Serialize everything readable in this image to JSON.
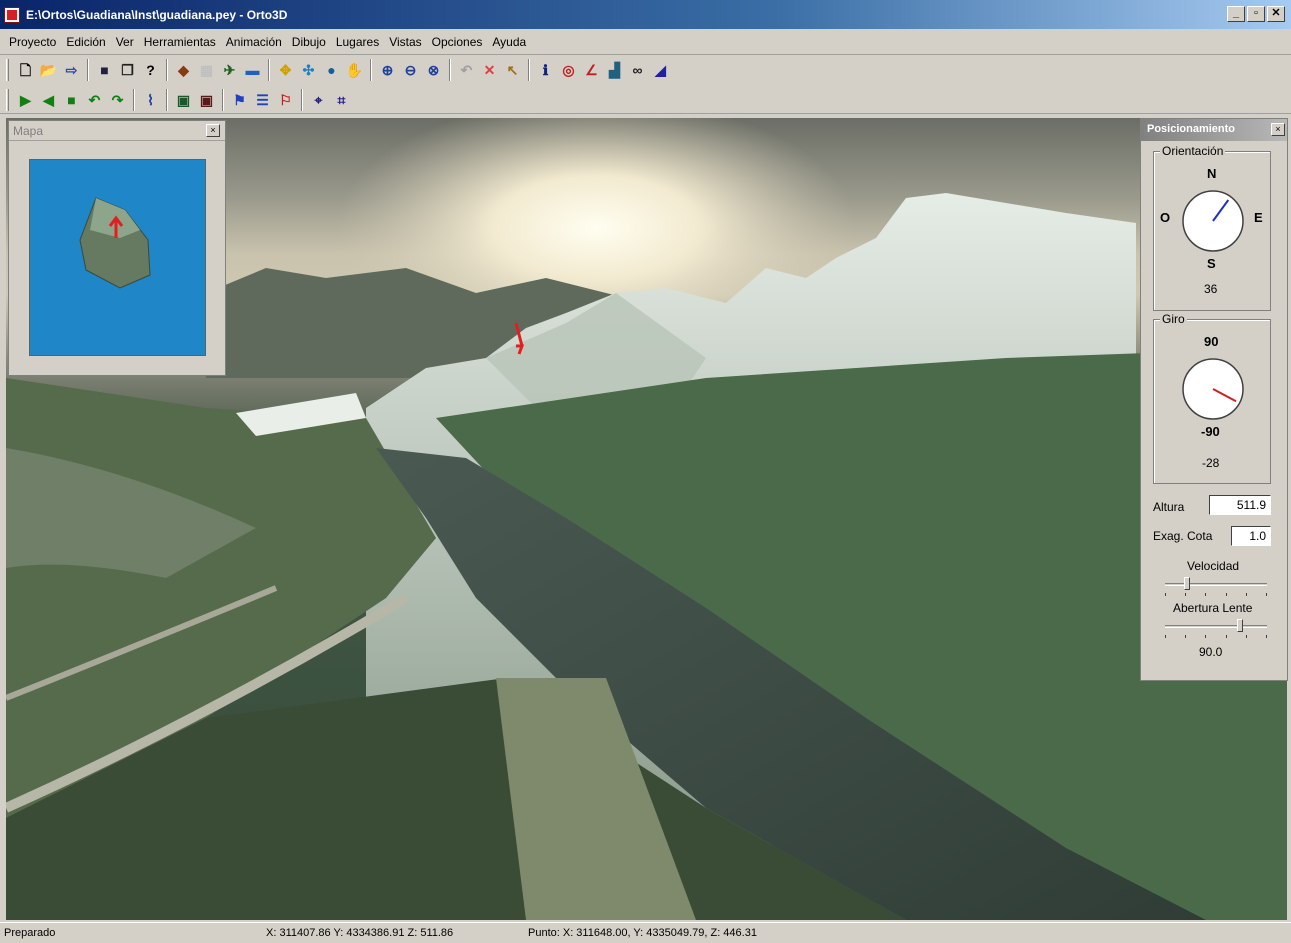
{
  "window": {
    "title": "E:\\Ortos\\Guadiana\\Inst\\guadiana.pey - Orto3D",
    "min_label": "_",
    "max_label": "▫",
    "close_label": "✕"
  },
  "menu": [
    "Proyecto",
    "Edición",
    "Ver",
    "Herramientas",
    "Animación",
    "Dibujo",
    "Lugares",
    "Vistas",
    "Opciones",
    "Ayuda"
  ],
  "toolbar1": [
    {
      "icon": "new-file-icon",
      "glyph": "🗋",
      "color": "#000000"
    },
    {
      "icon": "open-folder-icon",
      "glyph": "📂",
      "color": "#c89a20"
    },
    {
      "icon": "open-recent-icon",
      "glyph": "⇨",
      "color": "#2050b0"
    },
    {
      "sep": true
    },
    {
      "icon": "save-icon",
      "glyph": "■",
      "color": "#202040"
    },
    {
      "icon": "copy-icon",
      "glyph": "❐",
      "color": "#202020"
    },
    {
      "icon": "help-icon",
      "glyph": "?",
      "color": "#000000"
    },
    {
      "sep": true
    },
    {
      "icon": "terrain-icon",
      "glyph": "◆",
      "color": "#8a3a10"
    },
    {
      "icon": "grid-icon",
      "glyph": "▦",
      "color": "#c0c0c0"
    },
    {
      "icon": "plane-icon",
      "glyph": "✈",
      "color": "#206020"
    },
    {
      "icon": "landscape-icon",
      "glyph": "▬",
      "color": "#2060c0"
    },
    {
      "sep": true
    },
    {
      "icon": "move-icon",
      "glyph": "✥",
      "color": "#d0a000"
    },
    {
      "icon": "rotate-icon",
      "glyph": "✣",
      "color": "#2080c0"
    },
    {
      "icon": "globe-icon",
      "glyph": "●",
      "color": "#1060a0"
    },
    {
      "icon": "hand-icon",
      "glyph": "✋",
      "color": "#c0a080"
    },
    {
      "sep": true
    },
    {
      "icon": "zoom-in-icon",
      "glyph": "⊕",
      "color": "#2040a0"
    },
    {
      "icon": "zoom-out-icon",
      "glyph": "⊖",
      "color": "#2040a0"
    },
    {
      "icon": "zoom-extent-icon",
      "glyph": "⊗",
      "color": "#2040a0"
    },
    {
      "sep": true
    },
    {
      "icon": "undo-disabled-icon",
      "glyph": "↶",
      "color": "#a0a0a0"
    },
    {
      "icon": "delete-icon",
      "glyph": "✕",
      "color": "#e04040"
    },
    {
      "icon": "pick-icon",
      "glyph": "↖",
      "color": "#a07010"
    },
    {
      "sep": true
    },
    {
      "icon": "info-icon",
      "glyph": "ℹ",
      "color": "#102080"
    },
    {
      "icon": "eye-icon",
      "glyph": "◎",
      "color": "#c02020"
    },
    {
      "icon": "measure-icon",
      "glyph": "∠",
      "color": "#c02020"
    },
    {
      "icon": "profile-icon",
      "glyph": "▟",
      "color": "#206080"
    },
    {
      "icon": "binoculars-icon",
      "glyph": "∞",
      "color": "#202020"
    },
    {
      "icon": "draw-area-icon",
      "glyph": "◢",
      "color": "#2020a0"
    }
  ],
  "toolbar2": [
    {
      "icon": "play-icon",
      "glyph": "▶",
      "color": "#108010"
    },
    {
      "icon": "play-back-icon",
      "glyph": "◀",
      "color": "#108010"
    },
    {
      "icon": "stop-icon",
      "glyph": "■",
      "color": "#108010"
    },
    {
      "icon": "rotate-left-icon",
      "glyph": "↶",
      "color": "#108010"
    },
    {
      "icon": "rotate-right-icon",
      "glyph": "↷",
      "color": "#108010"
    },
    {
      "sep": true
    },
    {
      "icon": "path-icon",
      "glyph": "⌇",
      "color": "#2040a0"
    },
    {
      "sep": true
    },
    {
      "icon": "record-icon",
      "glyph": "▣",
      "color": "#1a5a2a"
    },
    {
      "icon": "record-stop-icon",
      "glyph": "▣",
      "color": "#5a1a1a"
    },
    {
      "sep": true
    },
    {
      "icon": "waypoint-add-icon",
      "glyph": "⚑",
      "color": "#2040c0"
    },
    {
      "icon": "waypoint-list-icon",
      "glyph": "☰",
      "color": "#2040c0"
    },
    {
      "icon": "waypoint-delete-icon",
      "glyph": "⚐",
      "color": "#c02020"
    },
    {
      "sep": true
    },
    {
      "icon": "camera-add-icon",
      "glyph": "⌖",
      "color": "#202080"
    },
    {
      "icon": "camera-list-icon",
      "glyph": "⌗",
      "color": "#202080"
    }
  ],
  "mapa": {
    "title": "Mapa",
    "close_label": "×"
  },
  "posicionamiento": {
    "title": "Posicionamiento",
    "close_label": "×",
    "orientacion": {
      "label": "Orientación",
      "n": "N",
      "s": "S",
      "e": "E",
      "o": "O",
      "value": "36",
      "angle_deg": 36
    },
    "giro": {
      "label": "Giro",
      "top": "90",
      "bottom": "-90",
      "value": "-28",
      "angle_deg": -28
    },
    "altura": {
      "label": "Altura",
      "value": "511.9"
    },
    "exag_cota": {
      "label": "Exag. Cota",
      "value": "1.0"
    },
    "velocidad": {
      "label": "Velocidad",
      "fraction": 0.2
    },
    "abertura": {
      "label": "Abertura Lente",
      "value": "90.0",
      "fraction": 0.75
    }
  },
  "status": {
    "state": "Preparado",
    "cursor": "X: 311407.86 Y: 4334386.91 Z: 511.86",
    "point": "Punto: X: 311648.00, Y: 4335049.79, Z: 446.31"
  },
  "colors": {
    "map_water": "#1f86c8",
    "marker": "#e02020",
    "title_bar": "#0a246a"
  }
}
